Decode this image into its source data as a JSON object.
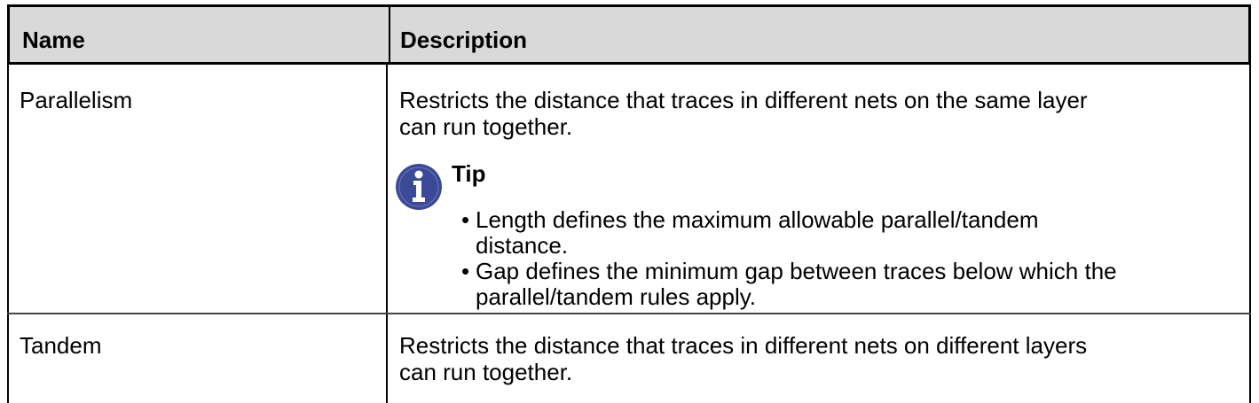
{
  "table": {
    "headers": {
      "name": "Name",
      "description": "Description"
    },
    "rows": [
      {
        "name": "Parallelism",
        "description_lines": [
          "Restricts the distance that traces in different nets on the same layer",
          "can run together."
        ],
        "tip": {
          "icon": "info-icon",
          "title": "Tip",
          "bullets": [
            {
              "lines": [
                "Length defines the maximum allowable parallel/tandem",
                "distance."
              ]
            },
            {
              "lines": [
                "Gap defines the minimum gap between traces below which the",
                "parallel/tandem rules apply."
              ]
            }
          ]
        }
      },
      {
        "name": "Tandem",
        "description_lines": [
          "Restricts the distance that traces in different nets on different layers",
          "can run together."
        ]
      }
    ]
  },
  "colors": {
    "header_background": "#d9d9d9",
    "border": "#000000",
    "tip_icon": "#3b4a96"
  }
}
